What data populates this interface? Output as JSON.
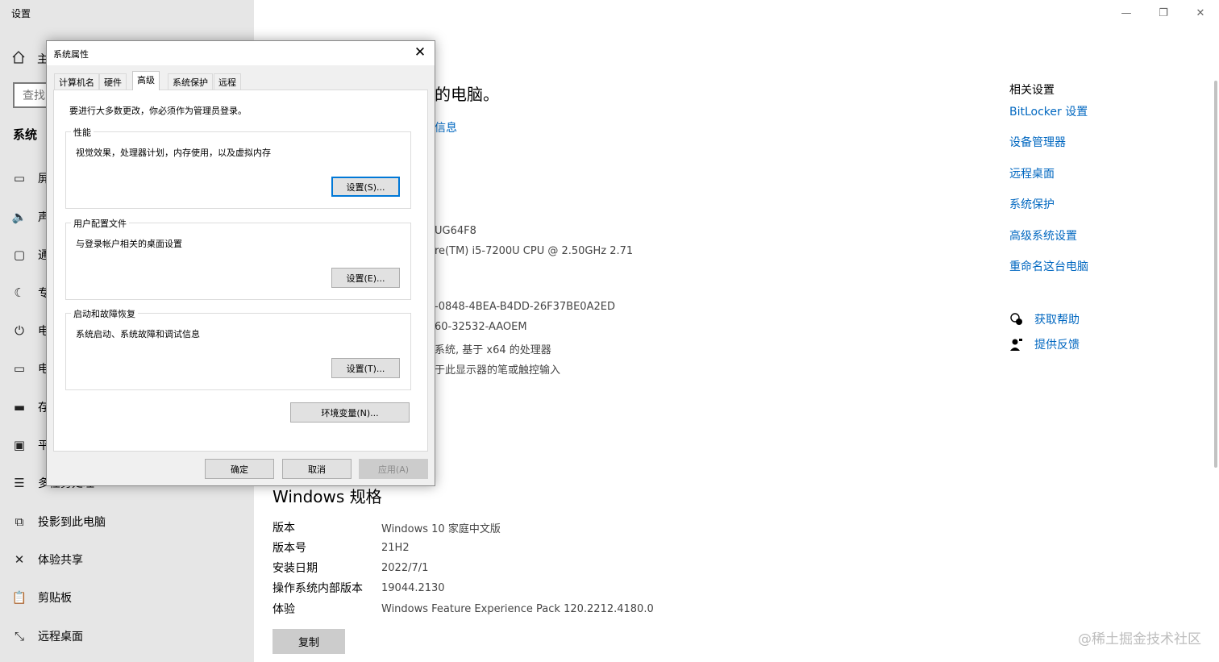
{
  "app": {
    "title": "设置"
  },
  "window_controls": {
    "minimize": "—",
    "restore": "❐",
    "close": "✕"
  },
  "sidebar": {
    "home_label": "主",
    "search_placeholder": "查找",
    "section": "系统",
    "items": [
      {
        "label": "屏",
        "icon": "monitor-icon",
        "glyph": "▭"
      },
      {
        "label": "声",
        "icon": "speaker-icon",
        "glyph": "🔈"
      },
      {
        "label": "通",
        "icon": "notification-icon",
        "glyph": "▢"
      },
      {
        "label": "专",
        "icon": "moon-icon",
        "glyph": "☾"
      },
      {
        "label": "电",
        "icon": "power-icon",
        "glyph": "⏻"
      },
      {
        "label": "电",
        "icon": "battery-icon",
        "glyph": "▭"
      },
      {
        "label": "存",
        "icon": "storage-icon",
        "glyph": "▬"
      },
      {
        "label": "平",
        "icon": "tablet-icon",
        "glyph": "▣"
      },
      {
        "label": "多任务处理",
        "icon": "multitasking-icon",
        "glyph": "☰"
      },
      {
        "label": "投影到此电脑",
        "icon": "project-icon",
        "glyph": "⧉"
      },
      {
        "label": "体验共享",
        "icon": "shared-experience-icon",
        "glyph": "✕"
      },
      {
        "label": "剪贴板",
        "icon": "clipboard-icon",
        "glyph": "📋"
      },
      {
        "label": "远程桌面",
        "icon": "remote-desktop-icon",
        "glyph": "⤡"
      }
    ]
  },
  "main": {
    "heading_fragment": "的电脑。",
    "link_fragment": "信息",
    "fragments": [
      "UG64F8",
      "re(TM) i5-7200U CPU @ 2.50GHz   2.71",
      "-0848-4BEA-B4DD-26F37BE0A2ED",
      "60-32532-AAOEM",
      "系统, 基于 x64 的处理器",
      "于此显示器的笔或触控输入"
    ],
    "specs_title": "Windows 规格",
    "specs": [
      {
        "key": "版本",
        "value": "Windows 10 家庭中文版"
      },
      {
        "key": "版本号",
        "value": "21H2"
      },
      {
        "key": "安装日期",
        "value": "2022/7/1"
      },
      {
        "key": "操作系统内部版本",
        "value": "19044.2130"
      },
      {
        "key": "体验",
        "value": "Windows Feature Experience Pack 120.2212.4180.0"
      }
    ],
    "copy_button": "复制"
  },
  "related": {
    "title": "相关设置",
    "links": [
      "BitLocker 设置",
      "设备管理器",
      "远程桌面",
      "系统保护",
      "高级系统设置",
      "重命名这台电脑"
    ],
    "help": "获取帮助",
    "feedback": "提供反馈"
  },
  "watermark": "@稀土掘金技术社区",
  "dialog": {
    "title": "系统属性",
    "close": "✕",
    "tabs": [
      "计算机名",
      "硬件",
      "高级",
      "系统保护",
      "远程"
    ],
    "active_tab": "高级",
    "admin_note": "要进行大多数更改，你必须作为管理员登录。",
    "performance": {
      "title": "性能",
      "desc": "视觉效果，处理器计划，内存使用，以及虚拟内存",
      "button": "设置(S)..."
    },
    "profiles": {
      "title": "用户配置文件",
      "desc": "与登录帐户相关的桌面设置",
      "button": "设置(E)..."
    },
    "startup": {
      "title": "启动和故障恢复",
      "desc": "系统启动、系统故障和调试信息",
      "button": "设置(T)..."
    },
    "env_button": "环境变量(N)...",
    "ok": "确定",
    "cancel": "取消",
    "apply": "应用(A)"
  }
}
